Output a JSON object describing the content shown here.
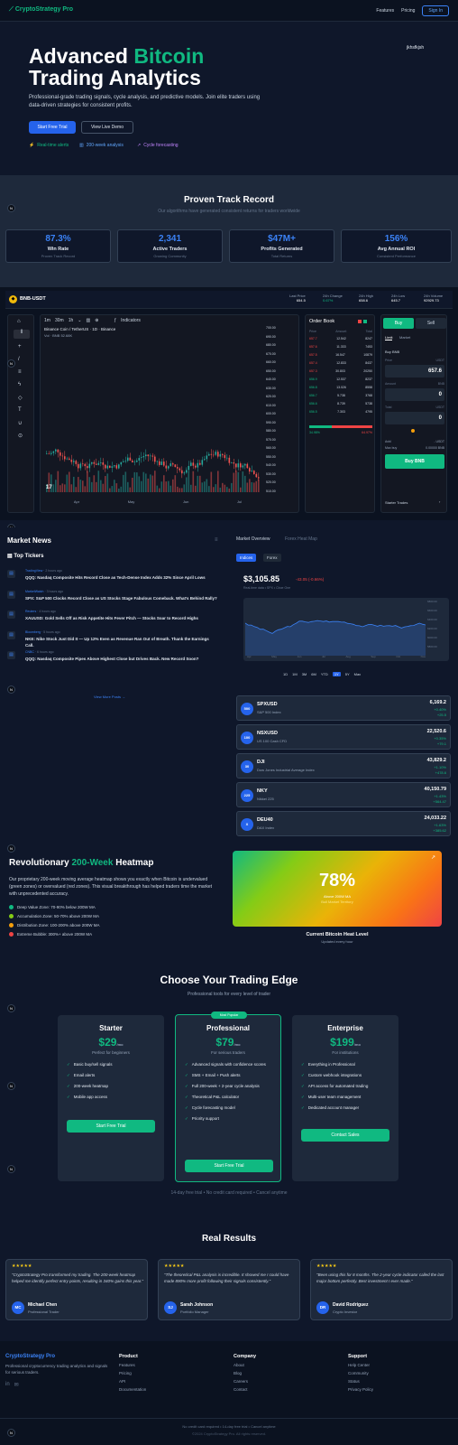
{
  "nav": {
    "brand": "CryptoStrategy Pro",
    "features": "Features",
    "pricing": "Pricing",
    "signin": "Sign In"
  },
  "hero": {
    "title_a": "Advanced ",
    "title_b": "Bitcoin",
    "title_c": "Trading Analytics",
    "subtitle": "Professional-grade trading signals, cycle analysis, and predictive models. Join elite traders using data-driven strategies for consistent profits.",
    "btn_primary": "Start Free Trial",
    "btn_secondary": "View Live Demo",
    "feat1": "Real-time alerts",
    "feat2": "200-week analysis",
    "feat3": "Cycle forecasting",
    "handle": "jkhsfkjsh"
  },
  "track": {
    "title": "Proven Track Record",
    "subtitle": "Our algorithms have generated consistent returns for traders worldwide",
    "stats": [
      {
        "value": "87.3%",
        "label": "Win Rate",
        "sub": "Proven Track Record"
      },
      {
        "value": "2,341",
        "label": "Active Traders",
        "sub": "Growing Community"
      },
      {
        "value": "$47M+",
        "label": "Profits Generated",
        "sub": "Total Returns"
      },
      {
        "value": "156%",
        "label": "Avg Annual ROI",
        "sub": "Consistent Performance"
      }
    ]
  },
  "tv": {
    "pair": "BNB-USDT",
    "stats": [
      {
        "k": "Last Price",
        "v": "654.5"
      },
      {
        "k": "24h Change",
        "v": "0.67%"
      },
      {
        "k": "24h High",
        "v": "658.6"
      },
      {
        "k": "24h Low",
        "v": "645.7"
      },
      {
        "k": "24h Volume",
        "v": "92929.73"
      }
    ],
    "chart_header": "Binance Coin / TetherUS · 1D · Binance",
    "vol": "Vol · BNB  52.68K",
    "indicators": "Indicators",
    "intervals": [
      "1m",
      "30m",
      "1h"
    ],
    "months": [
      "Apr",
      "May",
      "Jun",
      "Jul"
    ],
    "prices": [
      "700.00",
      "690.00",
      "680.00",
      "670.00",
      "660.00",
      "650.00",
      "640.00",
      "630.00",
      "620.00",
      "610.00",
      "600.00",
      "590.00",
      "580.00",
      "570.00",
      "560.00",
      "550.00",
      "540.00",
      "530.00",
      "520.00",
      "510.00"
    ],
    "orderbook": {
      "title": "Order Book",
      "cols": [
        "Price",
        "Amount",
        "Total"
      ],
      "asks": [
        [
          "657.7",
          "12.542",
          "8247"
        ],
        [
          "657.6",
          "11.333",
          "7453"
        ],
        [
          "657.5",
          "16.547",
          "10879"
        ],
        [
          "657.4",
          "12.833",
          "8437"
        ],
        [
          "657.3",
          "30.803",
          "20250"
        ]
      ],
      "bids": [
        [
          "656.9",
          "12.537",
          "8237"
        ],
        [
          "656.8",
          "13.026",
          "8558"
        ],
        [
          "656.7",
          "5.738",
          "3768"
        ],
        [
          "656.6",
          "8.739",
          "5738"
        ],
        [
          "656.5",
          "7.303",
          "4795"
        ]
      ],
      "buy_pct": "34.98%",
      "sell_pct": "64.97%"
    },
    "trade": {
      "buy": "Buy",
      "sell": "Sell",
      "limit": "Limit",
      "market": "Market",
      "buy_bnb": "Buy BNB",
      "price_lbl": "Price",
      "price_unit": "USDT",
      "price_val": "657.6",
      "amount_lbl": "Amount",
      "amount_unit": "BNB",
      "amount_val": "0",
      "total_lbl": "Total",
      "total_unit": "USDT",
      "total_val": "0",
      "avbl": "Avbl",
      "avbl_val": "- USDT",
      "maxbuy": "Max buy",
      "maxbuy_val": "0.00000 BNB",
      "buy_btn": "Buy BNB",
      "starter": "Starter Trades"
    }
  },
  "news": {
    "title": "Market News",
    "top": "Top Tickers",
    "items": [
      {
        "src": "TradingView",
        "time": "2 hours ago",
        "text": "QQQ: Nasdaq Composite Hits Record Close as Tech-Dense Index Adds 32% Since April Lows"
      },
      {
        "src": "MarketWatch",
        "time": "3 hours ago",
        "text": "SPX: S&P 500 Clocks Record Close as US Stocks Stage Fabulous Comeback. What's Behind Rally?"
      },
      {
        "src": "Reuters",
        "time": "4 hours ago",
        "text": "XAUUSD: Gold Sells Off as Risk Appetite Hits Fever Pitch — Stocks Soar to Record Highs"
      },
      {
        "src": "Bloomberg",
        "time": "5 hours ago",
        "text": "NKE: Nike Stock Just Did It — Up 12% Even as Revenue Ran Out of Breath. Thank the Earnings Call."
      },
      {
        "src": "CNBC",
        "time": "6 hours ago",
        "text": "QQQ: Nasdaq Composite Pipes Above Highest Close but Drives Back. New Record Soon?"
      }
    ],
    "more": "View More Posts →",
    "tabs": [
      "Market Overview",
      "Forex Heat Map"
    ],
    "subtabs": [
      "Indices",
      "Forex"
    ],
    "spx_price": "$3,105.85",
    "spx_change": "-43.05 (-0.66%)",
    "spx_meta": "Real-time data • SPX • Cboe One",
    "ranges": [
      "1D",
      "1M",
      "3M",
      "6M",
      "YTD",
      "1Y",
      "5Y",
      "Max"
    ],
    "yaxis": [
      "6800.00",
      "6600.00",
      "6400.00",
      "6200.00",
      "6000.00",
      "5800.00"
    ],
    "xaxis": [
      "Apr",
      "May",
      "Jun",
      "Jul",
      "Aug",
      "Sep",
      "Oct",
      "Nov"
    ],
    "indices": [
      {
        "sym": "SPXUSD",
        "name": "S&P 500 Index",
        "price": "6,169.2",
        "chg": "+0.40%",
        "chg2": "+25.5",
        "badge": "500",
        "color": "#2563eb"
      },
      {
        "sym": "NSXUSD",
        "name": "US 100 Cash CFD",
        "price": "22,520.6",
        "chg": "+0.35%",
        "chg2": "+79.1",
        "badge": "100",
        "color": "#2563eb"
      },
      {
        "sym": "DJI",
        "name": "Dow Jones Industrial Average Index",
        "price": "43,829.2",
        "chg": "+1.10%",
        "chg2": "+478.6",
        "badge": "30",
        "color": "#2563eb"
      },
      {
        "sym": "NKY",
        "name": "Nikkei 225",
        "price": "40,150.79",
        "chg": "+1.43%",
        "chg2": "+564.47",
        "badge": "225",
        "color": "#2563eb"
      },
      {
        "sym": "DEU40",
        "name": "DAX Index",
        "price": "24,033.22",
        "chg": "+1.63%",
        "chg2": "+385.62",
        "badge": "X",
        "color": "#2563eb"
      }
    ]
  },
  "heat": {
    "title_a": "Revolutionary ",
    "title_b": "200-Week",
    "title_c": " Heatmap",
    "desc": "Our proprietary 200-week moving average heatmap shows you exactly when Bitcoin is undervalued (green zones) or overvalued (red zones). This visual breakthrough has helped traders time the market with unprecedented accuracy.",
    "legend": [
      {
        "label": "Deep Value Zone: 70-90% below 200W MA",
        "color": "#10b981"
      },
      {
        "label": "Accumulation Zone: 50-70% above 200W MA",
        "color": "#84cc16"
      },
      {
        "label": "Distribution Zone: 100-200% above 200W MA",
        "color": "#f59e0b"
      },
      {
        "label": "Extreme Bubble: 300%+ above 200W MA",
        "color": "#ef4444"
      }
    ],
    "value": "78%",
    "vsub": "Above 200W MA",
    "vsub2": "Bull Market Territory",
    "caption": "Current Bitcoin Heat Level",
    "caption2": "Updated every hour"
  },
  "pricing": {
    "title": "Choose Your Trading Edge",
    "subtitle": "Professional tools for every level of trader",
    "popular": "Most Popular",
    "plans": [
      {
        "name": "Starter",
        "price": "$29",
        "per": "/mo",
        "sub": "Perfect for beginners",
        "features": [
          "Basic buy/sell signals",
          "Email alerts",
          "200-week heatmap",
          "Mobile app access"
        ],
        "btn": "Start Free Trial"
      },
      {
        "name": "Professional",
        "price": "$79",
        "per": "/mo",
        "sub": "For serious traders",
        "features": [
          "Advanced signals with confidence scores",
          "SMS + Email + Push alerts",
          "Full 200-week + 2-year cycle analysis",
          "Theoretical P&L calculator",
          "Cycle forecasting model",
          "Priority support"
        ],
        "btn": "Start Free Trial"
      },
      {
        "name": "Enterprise",
        "price": "$199",
        "per": "/mo",
        "sub": "For institutions",
        "features": [
          "Everything in Professional",
          "Custom webhook integrations",
          "API access for automated trading",
          "Multi-user team management",
          "Dedicated account manager"
        ],
        "btn": "Contact Sales"
      }
    ],
    "note": "14-day free trial • No credit card required • Cancel anytime"
  },
  "reviews": {
    "title": "Real Results",
    "stars": "★★★★★",
    "items": [
      {
        "quote": "\"CryptoStrategy Pro transformed my trading. The 200-week heatmap helped me identify perfect entry points, resulting in 340% gains this year.\"",
        "initials": "MC",
        "name": "Michael Chen",
        "role": "Professional Trader"
      },
      {
        "quote": "\"The theoretical P&L analysis is incredible. It showed me I could have made 890% more profit following their signals consistently.\"",
        "initials": "SJ",
        "name": "Sarah Johnson",
        "role": "Portfolio Manager"
      },
      {
        "quote": "\"Been using this for 8 months. The 2-year cycle indicator called the last major bottom perfectly. Best investment I ever made.\"",
        "initials": "DR",
        "name": "David Rodriguez",
        "role": "Crypto Investor"
      }
    ]
  },
  "footer": {
    "brand": "CryptoStrategy Pro",
    "desc": "Professional cryptocurrency trading analytics and signals for serious traders.",
    "cols": [
      {
        "h": "Product",
        "links": [
          "Features",
          "Pricing",
          "API",
          "Documentation"
        ]
      },
      {
        "h": "Company",
        "links": [
          "About",
          "Blog",
          "Careers",
          "Contact"
        ]
      },
      {
        "h": "Support",
        "links": [
          "Help Center",
          "Community",
          "Status",
          "Privacy Policy"
        ]
      }
    ],
    "note": "No credit card required • 14-day free trial • Cancel anytime",
    "copy": "©2024 CryptoStrategy Pro. All rights reserved."
  },
  "colors": {
    "accent": "#10b981",
    "primary": "#2563eb",
    "bg": "#0f172a"
  }
}
